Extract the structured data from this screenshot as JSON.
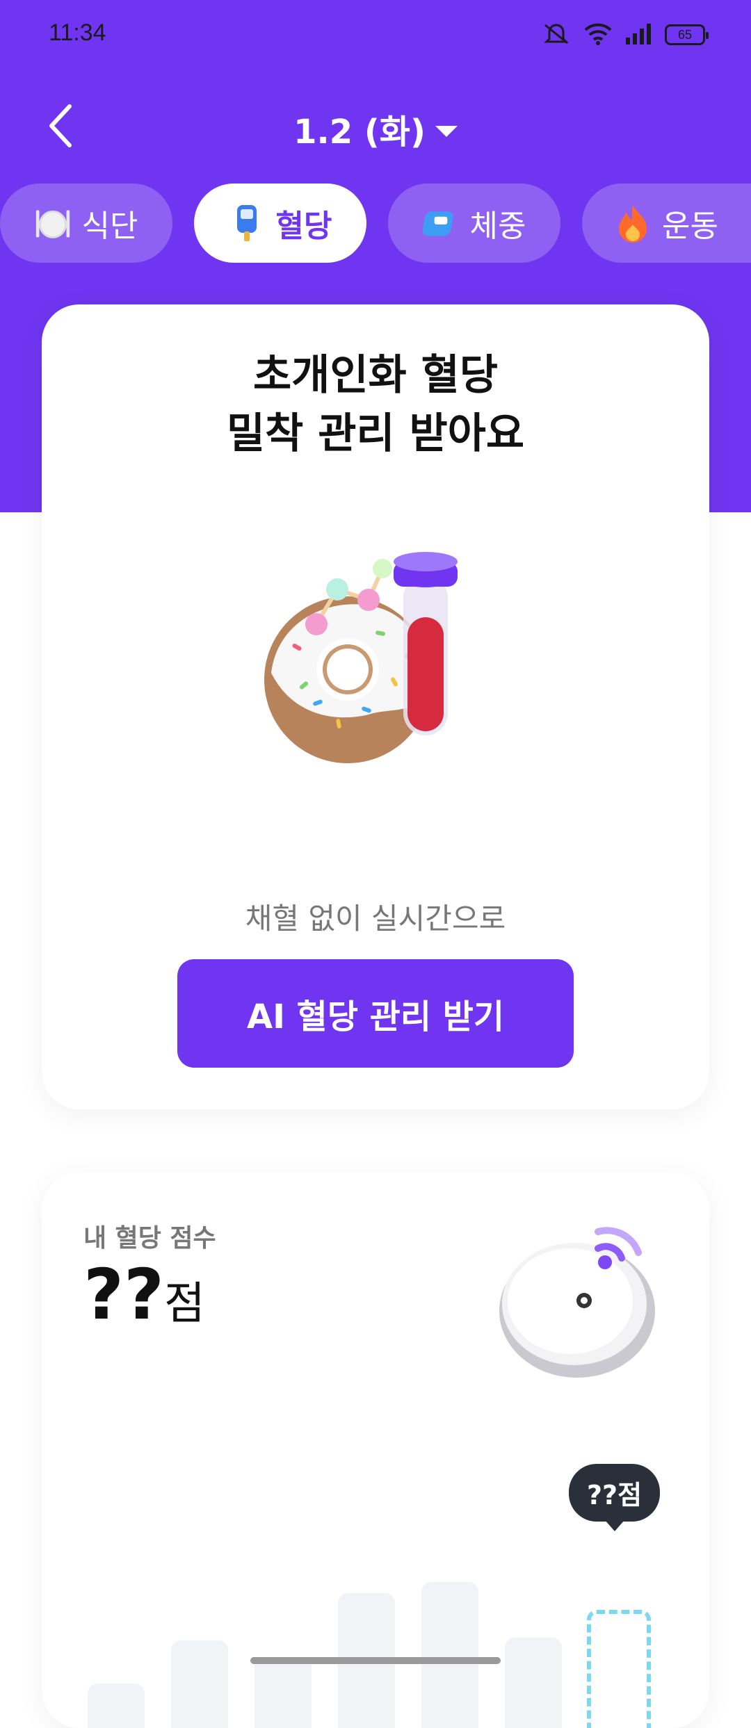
{
  "status_bar": {
    "time": "11:34",
    "battery": "65"
  },
  "header": {
    "date": "1.2 (화)"
  },
  "tabs": [
    {
      "label": "식단",
      "icon": "plate-icon"
    },
    {
      "label": "혈당",
      "icon": "glucose-meter-icon"
    },
    {
      "label": "체중",
      "icon": "scale-icon"
    },
    {
      "label": "운동",
      "icon": "fire-icon"
    }
  ],
  "promo_card": {
    "title_line1": "초개인화 혈당",
    "title_line2": "밀착 관리 받아요",
    "subtitle": "채혈 없이 실시간으로",
    "cta_label": "AI 혈당 관리 받기"
  },
  "score_card": {
    "label": "내 혈당 점수",
    "score": "??",
    "unit": "점",
    "bubble": "??점"
  },
  "colors": {
    "brand": "#6F35F0",
    "bar": "#F2F3F6",
    "current_bar": "#7ED7F2",
    "bubble": "#2B2F3A"
  }
}
